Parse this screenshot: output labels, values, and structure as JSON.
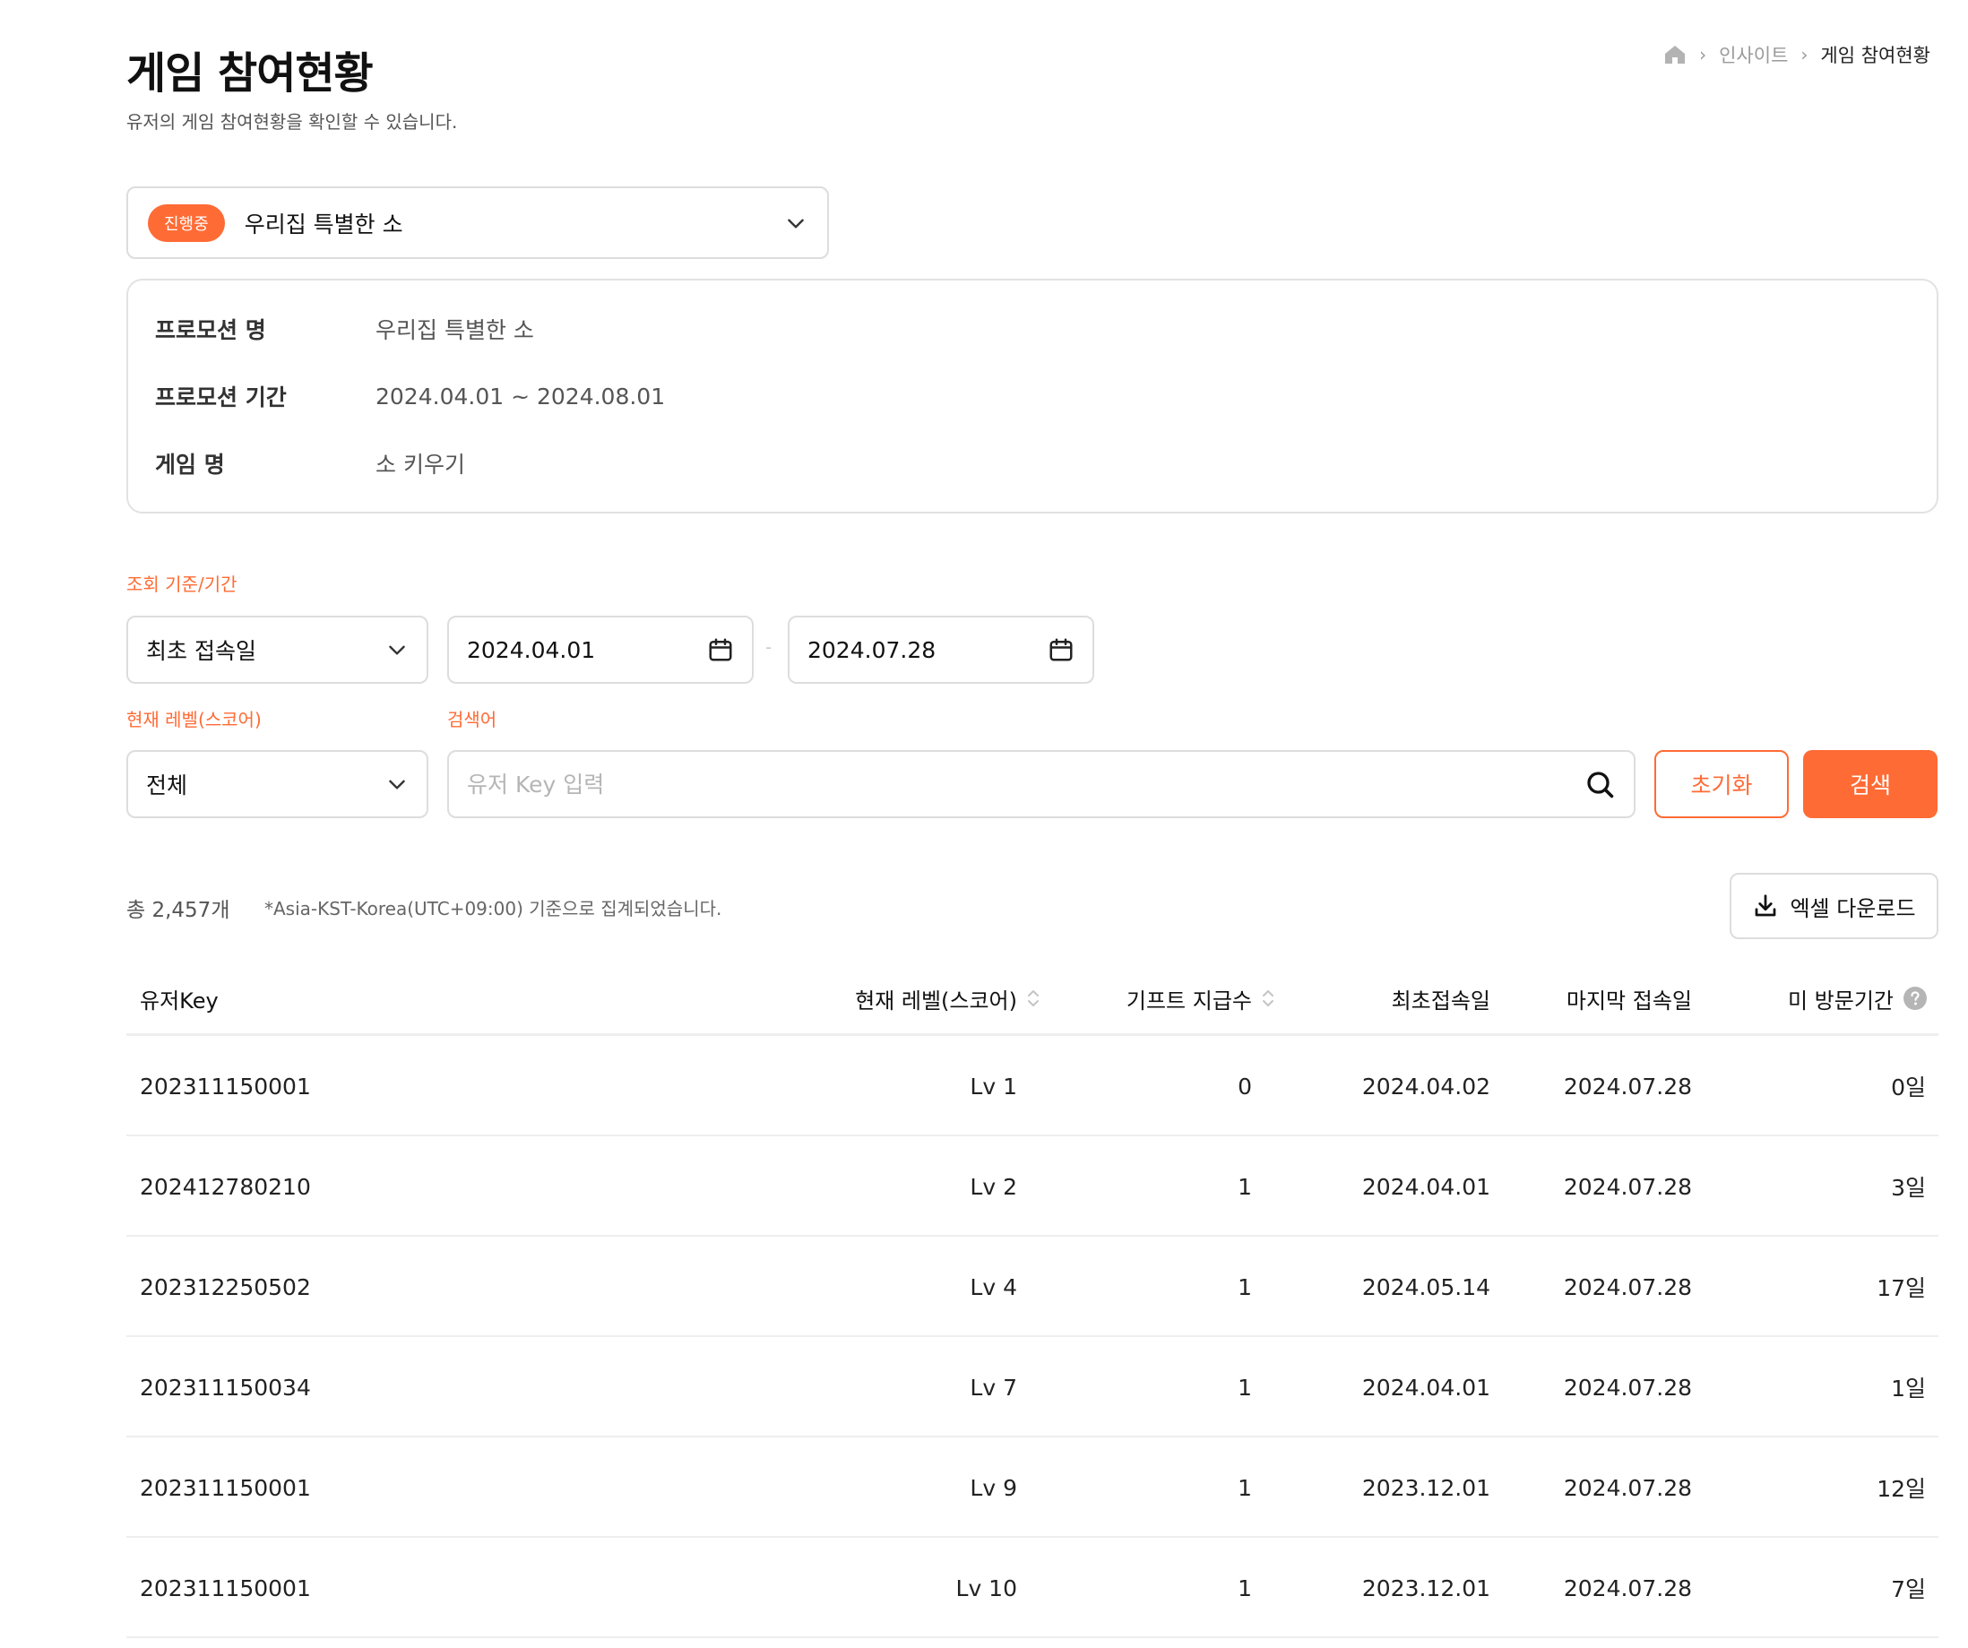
{
  "header": {
    "title": "게임 참여현황",
    "description": "유저의 게임 참여현황을 확인할 수 있습니다."
  },
  "breadcrumb": {
    "home_icon": "home-icon",
    "items": [
      "인사이트",
      "게임 참여현황"
    ]
  },
  "promotion_select": {
    "badge": "진행중",
    "selected": "우리집 특별한 소"
  },
  "promotion_info": {
    "rows": [
      {
        "label": "프로모션 명",
        "value": "우리집 특별한 소"
      },
      {
        "label": "프로모션 기간",
        "value": "2024.04.01 ~ 2024.08.01"
      },
      {
        "label": "게임 명",
        "value": "소 키우기"
      }
    ]
  },
  "filters": {
    "period_label": "조회 기준/기간",
    "period_type": "최초 접속일",
    "start_date": "2024.04.01",
    "end_date": "2024.07.28",
    "range_separator": "-",
    "level_label": "현재 레벨(스코어)",
    "level_value": "전체",
    "search_label": "검색어",
    "search_placeholder": "유저 Key 입력",
    "reset_label": "초기화",
    "search_button": "검색"
  },
  "summary": {
    "total": "총 2,457개",
    "timezone_note": "*Asia-KST-Korea(UTC+09:00) 기준으로 집계되었습니다.",
    "excel_button": "엑셀 다운로드"
  },
  "table": {
    "columns": [
      "유저Key",
      "현재 레벨(스코어)",
      "기프트 지급수",
      "최초접속일",
      "마지막 접속일",
      "미 방문기간"
    ],
    "rows": [
      [
        "202311150001",
        "Lv 1",
        "0",
        "2024.04.02",
        "2024.07.28",
        "0일"
      ],
      [
        "202412780210",
        "Lv 2",
        "1",
        "2024.04.01",
        "2024.07.28",
        "3일"
      ],
      [
        "202312250502",
        "Lv 4",
        "1",
        "2024.05.14",
        "2024.07.28",
        "17일"
      ],
      [
        "202311150034",
        "Lv 7",
        "1",
        "2024.04.01",
        "2024.07.28",
        "1일"
      ],
      [
        "202311150001",
        "Lv 9",
        "1",
        "2023.12.01",
        "2024.07.28",
        "12일"
      ],
      [
        "202311150001",
        "Lv 10",
        "1",
        "2023.12.01",
        "2024.07.28",
        "7일"
      ]
    ]
  },
  "colors": {
    "accent": "#ff6b35",
    "border": "#dddddd",
    "muted_text": "#9a9a9a"
  }
}
